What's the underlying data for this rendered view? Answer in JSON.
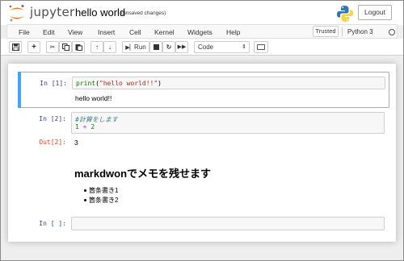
{
  "header": {
    "logo_text": "jupyter",
    "notebook_title": "hello world",
    "save_status": "(unsaved changes)",
    "logout_label": "Logout"
  },
  "menubar": {
    "items": [
      "File",
      "Edit",
      "View",
      "Insert",
      "Cell",
      "Kernel",
      "Widgets",
      "Help"
    ],
    "trusted_label": "Trusted",
    "kernel_name": "Python 3"
  },
  "toolbar": {
    "run_label": "Run",
    "cell_type": "Code"
  },
  "cells": [
    {
      "prompt": "In [1]:",
      "code_print": "print",
      "code_open": "(",
      "code_string": "\"hello world!!\"",
      "code_close": ")",
      "output": "hello world!!"
    },
    {
      "prompt": "In [2]:",
      "comment": "#計算をします",
      "num1": "1",
      "op": "+",
      "num2": "2",
      "out_prompt": "Out[2]:",
      "output": "3"
    },
    {
      "heading": "markdwonでメモを残せます",
      "items": [
        "箇条書き1",
        "箇条書き2"
      ]
    },
    {
      "prompt": "In [ ]:"
    }
  ],
  "colors": {
    "selected_cell_bar": "#42a5f5",
    "in_prompt": "#303f9f",
    "out_prompt": "#d84315"
  }
}
